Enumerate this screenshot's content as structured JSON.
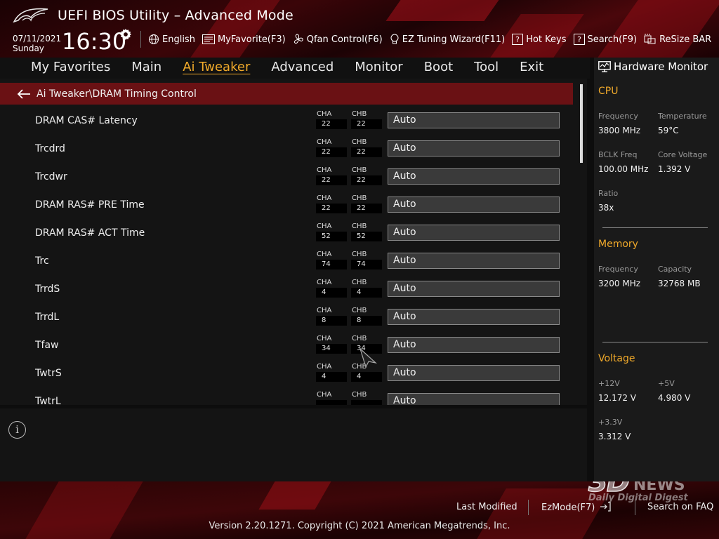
{
  "header": {
    "title": "UEFI BIOS Utility – Advanced Mode",
    "date": "07/11/2021",
    "day": "Sunday",
    "time": "16:30",
    "toolbar": [
      {
        "label": "English",
        "icon": "globe-icon"
      },
      {
        "label": "MyFavorite(F3)",
        "icon": "favorite-list-icon"
      },
      {
        "label": "Qfan Control(F6)",
        "icon": "fan-icon"
      },
      {
        "label": "EZ Tuning Wizard(F11)",
        "icon": "lightbulb-icon"
      },
      {
        "label": "Hot Keys",
        "icon": "question-box-icon"
      },
      {
        "label": "Search(F9)",
        "icon": "question-box-icon"
      },
      {
        "label": "ReSize BAR",
        "icon": "resize-bar-icon"
      }
    ]
  },
  "nav": {
    "tabs": [
      "My Favorites",
      "Main",
      "Ai Tweaker",
      "Advanced",
      "Monitor",
      "Boot",
      "Tool",
      "Exit"
    ],
    "active": "Ai Tweaker"
  },
  "breadcrumb": "Ai Tweaker\\DRAM Timing Control",
  "channel_labels": {
    "a": "CHA",
    "b": "CHB"
  },
  "settings": [
    {
      "label": "DRAM CAS# Latency",
      "cha": "22",
      "chb": "22",
      "value": "Auto"
    },
    {
      "label": "Trcdrd",
      "cha": "22",
      "chb": "22",
      "value": "Auto"
    },
    {
      "label": "Trcdwr",
      "cha": "22",
      "chb": "22",
      "value": "Auto"
    },
    {
      "label": "DRAM RAS# PRE Time",
      "cha": "22",
      "chb": "22",
      "value": "Auto"
    },
    {
      "label": "DRAM RAS# ACT Time",
      "cha": "52",
      "chb": "52",
      "value": "Auto"
    },
    {
      "label": "Trc",
      "cha": "74",
      "chb": "74",
      "value": "Auto"
    },
    {
      "label": "TrrdS",
      "cha": "4",
      "chb": "4",
      "value": "Auto"
    },
    {
      "label": "TrrdL",
      "cha": "8",
      "chb": "8",
      "value": "Auto"
    },
    {
      "label": "Tfaw",
      "cha": "34",
      "chb": "34",
      "value": "Auto"
    },
    {
      "label": "TwtrS",
      "cha": "4",
      "chb": "4",
      "value": "Auto"
    },
    {
      "label": "TwtrL",
      "cha": "",
      "chb": "",
      "value": "Auto"
    }
  ],
  "hardware_monitor": {
    "title": "Hardware Monitor",
    "cpu": {
      "heading": "CPU",
      "frequency_label": "Frequency",
      "frequency": "3800 MHz",
      "temperature_label": "Temperature",
      "temperature": "59°C",
      "bclk_label": "BCLK Freq",
      "bclk": "100.00 MHz",
      "core_voltage_label": "Core Voltage",
      "core_voltage": "1.392 V",
      "ratio_label": "Ratio",
      "ratio": "38x"
    },
    "memory": {
      "heading": "Memory",
      "frequency_label": "Frequency",
      "frequency": "3200 MHz",
      "capacity_label": "Capacity",
      "capacity": "32768 MB"
    },
    "voltage": {
      "heading": "Voltage",
      "v12_label": "+12V",
      "v12": "12.172 V",
      "v5_label": "+5V",
      "v5": "4.980 V",
      "v33_label": "+3.3V",
      "v33": "3.312 V"
    }
  },
  "footer": {
    "last_modified": "Last Modified",
    "ezmode": "EzMode(F7)",
    "search_faq": "Search on FAQ",
    "copyright": "Version 2.20.1271. Copyright (C) 2021 American Megatrends, Inc."
  },
  "watermark": {
    "number": "3D",
    "word": "NEWS",
    "tagline": "Daily Digital Digest"
  },
  "colors": {
    "accent": "#f0a92a",
    "breadcrumb_bg": "#6a1114",
    "value_box_bg": "#3a3a3a"
  }
}
